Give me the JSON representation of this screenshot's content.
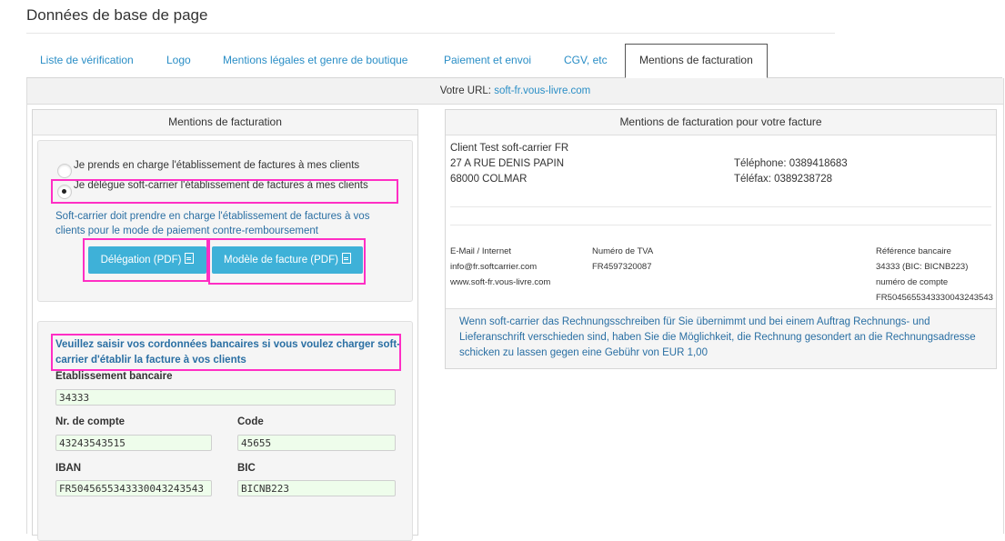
{
  "page": {
    "title": "Données de base de page"
  },
  "tabs": [
    {
      "label": "Liste de vérification",
      "active": false
    },
    {
      "label": "Logo",
      "active": false
    },
    {
      "label": "Mentions légales et genre de boutique",
      "active": false
    },
    {
      "label": "Paiement et envoi",
      "active": false
    },
    {
      "label": "CGV, etc",
      "active": false
    },
    {
      "label": "Mentions de facturation",
      "active": true
    }
  ],
  "url_bar": {
    "label": "Votre URL:",
    "link": "soft-fr.vous-livre.com"
  },
  "left_panel": {
    "title": "Mentions de facturation",
    "options": [
      {
        "label": "Je prends en charge l'établissement de factures à mes clients",
        "checked": false
      },
      {
        "label": "Je délègue soft-carrier l'établissement de factures à mes clients",
        "checked": true
      }
    ],
    "info_text": "Soft-carrier doit prendre en charge l'établissement de factures à vos clients pour le mode de paiement contre-remboursement",
    "buttons": {
      "delegation": "Délégation (PDF)",
      "model": "Modèle de facture (PDF)"
    },
    "bank": {
      "title": "Veuillez saisir vos cordonnées bancaires si vous voulez charger soft-carrier d'établir la facture à vos clients",
      "fields": {
        "establishment": {
          "label": "Etablissement bancaire",
          "value": "34333"
        },
        "account": {
          "label": "Nr. de compte",
          "value": "43243543515"
        },
        "code": {
          "label": "Code",
          "value": "45655"
        },
        "iban": {
          "label": "IBAN",
          "value": "FR5045655343330043243543"
        },
        "bic": {
          "label": "BIC",
          "value": "BICNB223"
        }
      }
    }
  },
  "right_panel": {
    "title": "Mentions de facturation pour votre facture",
    "address": {
      "line1": "Client Test soft-carrier FR",
      "line2": "27 A RUE DENIS PAPIN",
      "line3": "68000 COLMAR"
    },
    "phone": "Téléphone: 0389418683",
    "fax": "Téléfax: 0389238728",
    "footer": {
      "col1": {
        "line1": "E-Mail / Internet",
        "line2": "info@fr.softcarrier.com",
        "line3": "www.soft-fr.vous-livre.com"
      },
      "col2": {
        "line1": "Numéro de TVA",
        "line2": "FR4597320087"
      },
      "col3": {
        "line1": "Référence bancaire",
        "line2": "34333 (BIC: BICNB223)",
        "line3": "numéro de compte",
        "line4": "FR5045655343330043243543"
      }
    },
    "notice": "Wenn soft-carrier das Rechnungsschreiben für Sie übernimmt und bei einem Auftrag Rechnungs- und Lieferanschrift verschieden sind, haben Sie die Möglichkeit, die Rechnung gesondert an die Rechnungsadresse schicken zu lassen gegen eine Gebühr von EUR 1,00"
  },
  "colors": {
    "link": "#2a8ec6",
    "button": "#3eb1d8",
    "highlight": "#ff2ec4",
    "input_bg": "#eefdeb"
  }
}
